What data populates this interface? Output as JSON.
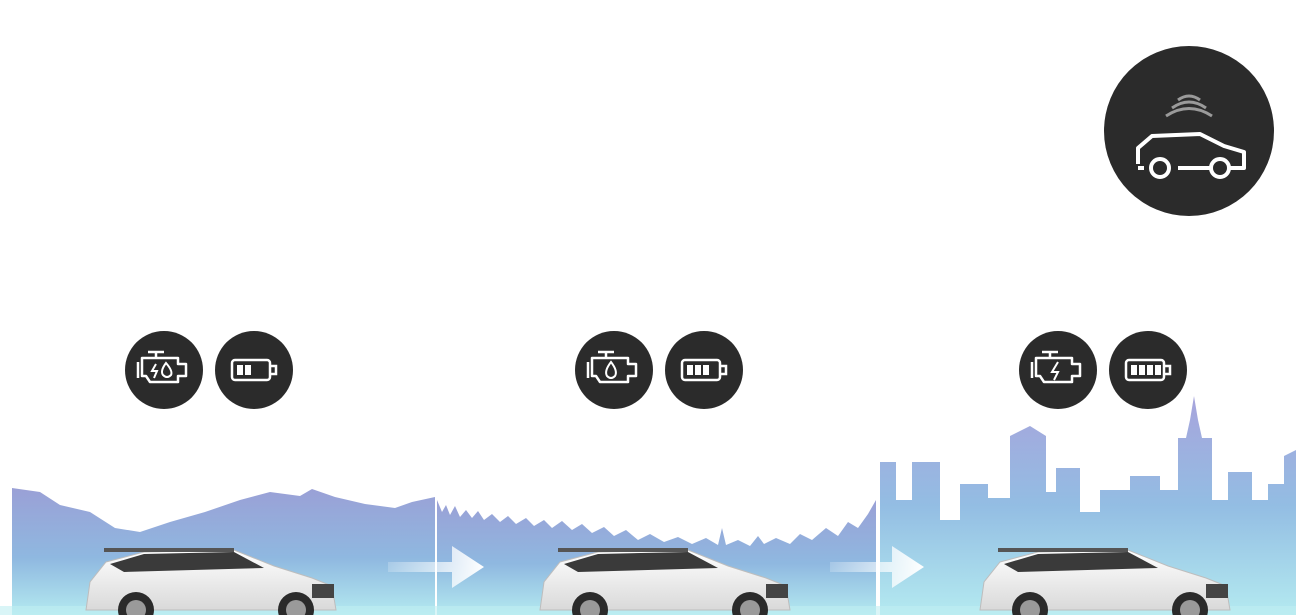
{
  "colors": {
    "background": "#ffffff",
    "icon_circle": "#2b2b2b",
    "icon_stroke": "#ffffff",
    "sky_top": "#9aa0d6",
    "sky_mid": "#8fb8e0",
    "sky_bottom": "#a9e3ec",
    "car_body": "#f2f2f2",
    "car_dark": "#2a2a2a"
  },
  "icons": {
    "top_right": "autonomous-car-icon",
    "panel_1": [
      "engine-hybrid-drop-icon",
      "battery-two-bars-icon"
    ],
    "panel_2": [
      "engine-drop-icon",
      "battery-three-bars-icon"
    ],
    "panel_3": [
      "engine-electric-icon",
      "battery-four-bars-icon"
    ]
  },
  "panels": [
    {
      "scene": "mountains",
      "battery_level": 0.5
    },
    {
      "scene": "forest",
      "battery_level": 0.75
    },
    {
      "scene": "city",
      "battery_level": 1.0
    }
  ]
}
